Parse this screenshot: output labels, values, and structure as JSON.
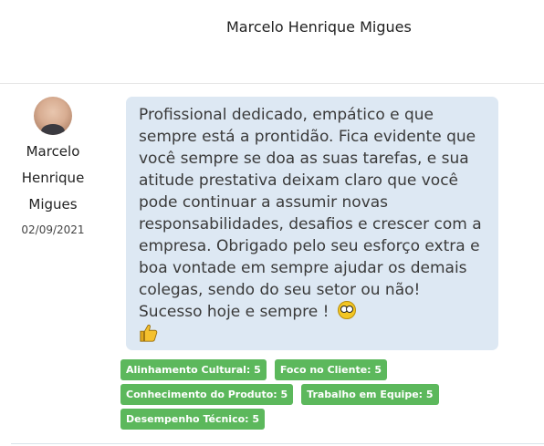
{
  "header": {
    "title": "Marcelo Henrique Migues"
  },
  "author": {
    "name_line1": "Marcelo",
    "name_line2": "Henrique",
    "name_line3": "Migues",
    "date": "02/09/2021"
  },
  "message": {
    "text": "Profissional dedicado, empático e que sempre está a prontidão. Fica evidente que você sempre se doa as suas tarefas, e sua atitude prestativa deixam claro que você pode continuar a assumir novas responsabilidades, desafios e crescer com a empresa. Obrigado pelo seu esforço extra e boa vontade em sempre ajudar os demais colegas, sendo do seu setor ou não! Sucesso hoje e sempre !",
    "emojis": [
      "astonished-face-icon",
      "thumbs-up-icon"
    ]
  },
  "tags": [
    {
      "label": "Alinhamento Cultural: 5"
    },
    {
      "label": "Foco no Cliente: 5"
    },
    {
      "label": "Conhecimento do Produto: 5"
    },
    {
      "label": "Trabalho em Equipe: 5"
    },
    {
      "label": "Desempenho Técnico: 5"
    }
  ],
  "colors": {
    "bubble_bg": "#dde8f3",
    "tag_bg": "#5cb85c",
    "tag_text": "#ffffff"
  }
}
